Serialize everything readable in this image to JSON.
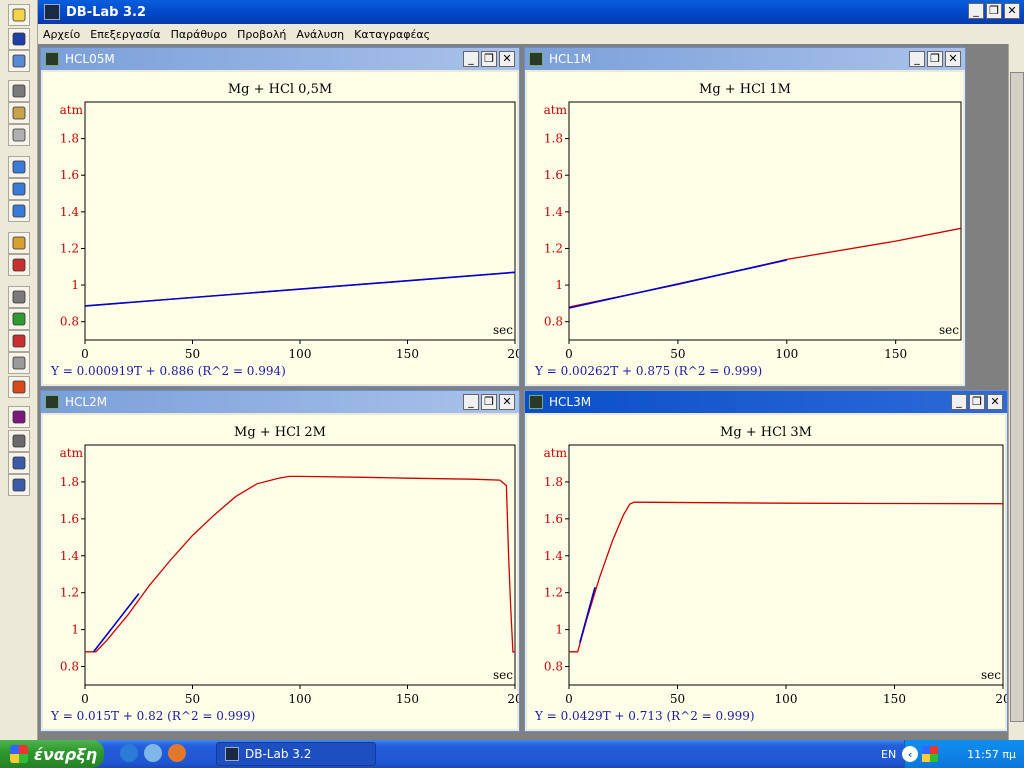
{
  "app": {
    "title": "DB-Lab 3.2"
  },
  "window_buttons": {
    "minimize": "_",
    "restore": "❐",
    "close": "✕"
  },
  "menu": [
    "Αρχείο",
    "Επεξεργασία",
    "Παράθυρο",
    "Προβολή",
    "Ανάλυση",
    "Καταγραφέας"
  ],
  "toolbar": {
    "buttons": [
      "new-folder-icon",
      "save-icon",
      "print-icon",
      "cut-icon",
      "copy-icon",
      "paste-icon",
      "zoom-in-icon",
      "zoom-out-icon",
      "zoom-reset-icon",
      "add-marker-icon",
      "delete-marker-icon",
      "calculator-icon",
      "wand-icon",
      "brush-icon",
      "probe-icon",
      "hand-icon",
      "color-icon",
      "gauge-icon",
      "table-icon",
      "graph-icon"
    ]
  },
  "windows": [
    {
      "id": "w1",
      "name": "HCL05M",
      "active": false
    },
    {
      "id": "w2",
      "name": "HCL1M",
      "active": false
    },
    {
      "id": "w3",
      "name": "HCL2M",
      "active": false
    },
    {
      "id": "w4",
      "name": "HCL3M",
      "active": true
    }
  ],
  "chart_data": [
    {
      "type": "line",
      "title": "Mg + HCl 0,5M",
      "ylabel": "atm",
      "xlabel": "sec",
      "xlim": [
        0,
        200
      ],
      "ylim": [
        0.7,
        2.0
      ],
      "xticks": [
        0,
        50,
        100,
        150,
        200
      ],
      "xtick_labels": [
        "0",
        "50",
        "100",
        "150",
        "20"
      ],
      "yticks": [
        0.8,
        1.0,
        1.2,
        1.4,
        1.6,
        1.8
      ],
      "ytick_labels": [
        "0.8",
        "1",
        "1.2",
        "1.4",
        "1.6",
        "1.8"
      ],
      "series": [
        {
          "color": "#cc0000",
          "points": [
            [
              0,
              0.885
            ],
            [
              50,
              0.932
            ],
            [
              100,
              0.978
            ],
            [
              150,
              1.023
            ],
            [
              200,
              1.07
            ]
          ]
        },
        {
          "color": "#0000cc",
          "points": [
            [
              0,
              0.886
            ],
            [
              200,
              1.07
            ]
          ]
        }
      ],
      "equation": "Y = 0.000919T + 0.886 (R^2 = 0.994)"
    },
    {
      "type": "line",
      "title": "Mg + HCl 1M",
      "ylabel": "atm",
      "xlabel": "sec",
      "xlim": [
        0,
        180
      ],
      "ylim": [
        0.7,
        2.0
      ],
      "xticks": [
        0,
        50,
        100,
        150
      ],
      "xtick_labels": [
        "0",
        "50",
        "100",
        "150"
      ],
      "yticks": [
        0.8,
        1.0,
        1.2,
        1.4,
        1.6,
        1.8
      ],
      "ytick_labels": [
        "0.8",
        "1",
        "1.2",
        "1.4",
        "1.6",
        "1.8"
      ],
      "series": [
        {
          "color": "#cc0000",
          "points": [
            [
              0,
              0.88
            ],
            [
              50,
              1.003
            ],
            [
              100,
              1.14
            ],
            [
              150,
              1.24
            ],
            [
              180,
              1.31
            ]
          ]
        },
        {
          "color": "#0000cc",
          "points": [
            [
              0,
              0.875
            ],
            [
              100,
              1.137
            ]
          ]
        }
      ],
      "equation": "Y = 0.00262T + 0.875 (R^2 = 0.999)"
    },
    {
      "type": "line",
      "title": "Mg + HCl 2M",
      "ylabel": "atm",
      "xlabel": "sec",
      "xlim": [
        0,
        200
      ],
      "ylim": [
        0.7,
        2.0
      ],
      "xticks": [
        0,
        50,
        100,
        150,
        200
      ],
      "xtick_labels": [
        "0",
        "50",
        "100",
        "150",
        "20"
      ],
      "yticks": [
        0.8,
        1.0,
        1.2,
        1.4,
        1.6,
        1.8
      ],
      "ytick_labels": [
        "0.8",
        "1",
        "1.2",
        "1.4",
        "1.6",
        "1.8"
      ],
      "series": [
        {
          "color": "#cc0000",
          "points": [
            [
              0,
              0.88
            ],
            [
              5,
              0.88
            ],
            [
              10,
              0.94
            ],
            [
              20,
              1.08
            ],
            [
              30,
              1.24
            ],
            [
              40,
              1.38
            ],
            [
              50,
              1.51
            ],
            [
              60,
              1.62
            ],
            [
              70,
              1.72
            ],
            [
              80,
              1.79
            ],
            [
              90,
              1.82
            ],
            [
              95,
              1.83
            ],
            [
              100,
              1.83
            ],
            [
              130,
              1.825
            ],
            [
              150,
              1.82
            ],
            [
              180,
              1.815
            ],
            [
              193,
              1.81
            ],
            [
              196,
              1.78
            ],
            [
              197,
              1.4
            ],
            [
              198,
              1.12
            ],
            [
              199,
              0.88
            ],
            [
              200,
              0.88
            ]
          ]
        },
        {
          "color": "#0000cc",
          "points": [
            [
              4,
              0.88
            ],
            [
              25,
              1.195
            ]
          ]
        }
      ],
      "equation": "Y = 0.015T + 0.82 (R^2 = 0.999)"
    },
    {
      "type": "line",
      "title": "Mg + HCl 3M",
      "ylabel": "atm",
      "xlabel": "sec",
      "xlim": [
        0,
        200
      ],
      "ylim": [
        0.7,
        2.0
      ],
      "xticks": [
        0,
        50,
        100,
        150,
        200
      ],
      "xtick_labels": [
        "0",
        "50",
        "100",
        "150",
        "20"
      ],
      "yticks": [
        0.8,
        1.0,
        1.2,
        1.4,
        1.6,
        1.8
      ],
      "ytick_labels": [
        "0.8",
        "1",
        "1.2",
        "1.4",
        "1.6",
        "1.8"
      ],
      "series": [
        {
          "color": "#cc0000",
          "points": [
            [
              0,
              0.88
            ],
            [
              4,
              0.88
            ],
            [
              8,
              1.05
            ],
            [
              14,
              1.28
            ],
            [
              20,
              1.48
            ],
            [
              25,
              1.62
            ],
            [
              28,
              1.68
            ],
            [
              30,
              1.69
            ],
            [
              100,
              1.685
            ],
            [
              150,
              1.683
            ],
            [
              200,
              1.682
            ]
          ]
        },
        {
          "color": "#0000cc",
          "points": [
            [
              5,
              0.93
            ],
            [
              12,
              1.23
            ]
          ]
        }
      ],
      "equation": "Y = 0.0429T + 0.713 (R^2 = 0.999)"
    }
  ],
  "taskbar": {
    "start_label": "έναρξη",
    "task_label": "DB-Lab 3.2",
    "language": "EN",
    "time": "11:57 πμ"
  }
}
